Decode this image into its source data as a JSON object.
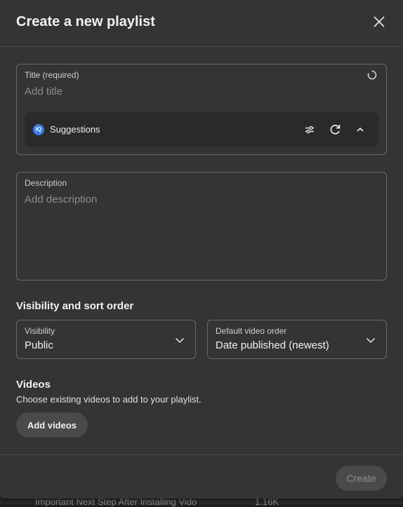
{
  "dialog": {
    "title": "Create a new playlist"
  },
  "title_field": {
    "label": "Title (required)",
    "placeholder": "Add title",
    "value": ""
  },
  "suggestions": {
    "logo_text": "IQ",
    "label": "Suggestions"
  },
  "description_field": {
    "label": "Description",
    "placeholder": "Add description",
    "value": ""
  },
  "visibility_section": {
    "title": "Visibility and sort order",
    "visibility": {
      "label": "Visibility",
      "value": "Public"
    },
    "order": {
      "label": "Default video order",
      "value": "Date published (newest)"
    }
  },
  "videos_section": {
    "title": "Videos",
    "description": "Choose existing videos to add to your playlist.",
    "add_button": "Add videos"
  },
  "footer": {
    "create_button": "Create"
  },
  "background": {
    "left_text": "Important Next Step After Installing Vido",
    "right_text": "1.16K"
  },
  "colors": {
    "dialog_bg": "#343434",
    "accent_logo": "#3b7ce8",
    "disabled_text": "#8f8f8f"
  }
}
